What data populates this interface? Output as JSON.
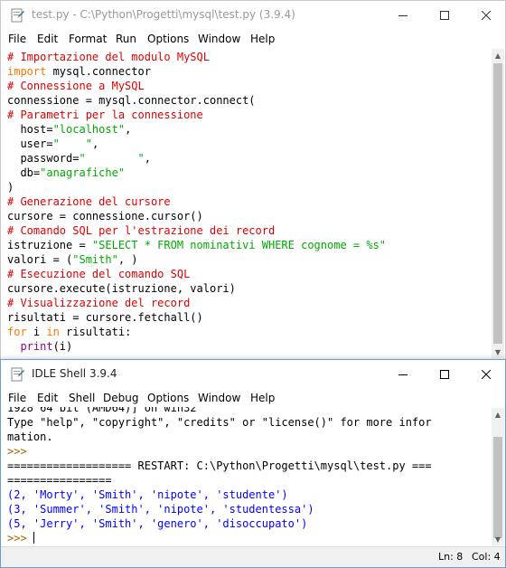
{
  "editor": {
    "title": "test.py - C:\\Python\\Progetti\\mysql\\test.py (3.9.4)",
    "menu": [
      "File",
      "Edit",
      "Format",
      "Run",
      "Options",
      "Window",
      "Help"
    ],
    "code_lines": [
      [
        {
          "t": "# Importazione del modulo MySQL",
          "c": "com"
        }
      ],
      [
        {
          "t": "import",
          "c": "kw"
        },
        {
          "t": " mysql.connector",
          "c": ""
        }
      ],
      [
        {
          "t": "# Connessione a MySQL",
          "c": "com"
        }
      ],
      [
        {
          "t": "connessione = mysql.connector.connect(",
          "c": ""
        }
      ],
      [
        {
          "t": "# Parametri per la connessione",
          "c": "com"
        }
      ],
      [
        {
          "t": "  host=",
          "c": ""
        },
        {
          "t": "\"localhost\"",
          "c": "str"
        },
        {
          "t": ",",
          "c": ""
        }
      ],
      [
        {
          "t": "  user=",
          "c": ""
        },
        {
          "t": "\"    \"",
          "c": "str"
        },
        {
          "t": ",",
          "c": ""
        }
      ],
      [
        {
          "t": "  password=",
          "c": ""
        },
        {
          "t": "\"        \"",
          "c": "str"
        },
        {
          "t": ",",
          "c": ""
        }
      ],
      [
        {
          "t": "  db=",
          "c": ""
        },
        {
          "t": "\"anagrafiche\"",
          "c": "str"
        }
      ],
      [
        {
          "t": ")",
          "c": ""
        }
      ],
      [
        {
          "t": "# Generazione del cursore",
          "c": "com"
        }
      ],
      [
        {
          "t": "cursore = connessione.cursor()",
          "c": ""
        }
      ],
      [
        {
          "t": "# Comando SQL per l'estrazione dei record",
          "c": "com"
        }
      ],
      [
        {
          "t": "istruzione = ",
          "c": ""
        },
        {
          "t": "\"SELECT * FROM nominativi WHERE cognome = %s\"",
          "c": "str"
        }
      ],
      [
        {
          "t": "valori = (",
          "c": ""
        },
        {
          "t": "\"Smith\"",
          "c": "str"
        },
        {
          "t": ", )",
          "c": ""
        }
      ],
      [
        {
          "t": "# Esecuzione del comando SQL",
          "c": "com"
        }
      ],
      [
        {
          "t": "cursore.execute(istruzione, valori)",
          "c": ""
        }
      ],
      [
        {
          "t": "# Visualizzazione del record",
          "c": "com"
        }
      ],
      [
        {
          "t": "risultati = cursore.fetchall()",
          "c": ""
        }
      ],
      [
        {
          "t": "for",
          "c": "kw"
        },
        {
          "t": " i ",
          "c": ""
        },
        {
          "t": "in",
          "c": "kw"
        },
        {
          "t": " risultati:",
          "c": ""
        }
      ],
      [
        {
          "t": "  ",
          "c": ""
        },
        {
          "t": "print",
          "c": "bi"
        },
        {
          "t": "(i)",
          "c": ""
        }
      ]
    ]
  },
  "shell": {
    "title": "IDLE Shell 3.9.4",
    "menu": [
      "File",
      "Edit",
      "Shell",
      "Debug",
      "Options",
      "Window",
      "Help"
    ],
    "lines": [
      [
        {
          "t": "1928 64 bit (AMD64)] on win32",
          "c": ""
        }
      ],
      [
        {
          "t": "Type \"help\", \"copyright\", \"credits\" or \"license()\" for more infor",
          "c": ""
        }
      ],
      [
        {
          "t": "mation.",
          "c": ""
        }
      ],
      [
        {
          "t": ">>> ",
          "c": "prompt"
        }
      ],
      [
        {
          "t": "=================== RESTART: C:\\Python\\Progetti\\mysql\\test.py ===",
          "c": ""
        }
      ],
      [
        {
          "t": "================",
          "c": ""
        }
      ],
      [
        {
          "t": "(2, 'Morty', 'Smith', 'nipote', 'studente')",
          "c": "out"
        }
      ],
      [
        {
          "t": "(3, 'Summer', 'Smith', 'nipote', 'studentessa')",
          "c": "out"
        }
      ],
      [
        {
          "t": "(5, 'Jerry', 'Smith', 'genero', 'disoccupato')",
          "c": "out"
        }
      ],
      [
        {
          "t": ">>> ",
          "c": "prompt"
        }
      ]
    ],
    "status": {
      "line": "Ln: 8",
      "col": "Col: 4"
    }
  },
  "colors": {
    "comment": "#dd0000",
    "keyword": "#ff7700",
    "string": "#00aa00",
    "builtin": "#900090",
    "output": "#0000ff",
    "prompt": "#a65f00"
  },
  "icons": [
    "python-file-icon",
    "minimize-icon",
    "maximize-icon",
    "close-icon",
    "idle-shell-icon"
  ]
}
